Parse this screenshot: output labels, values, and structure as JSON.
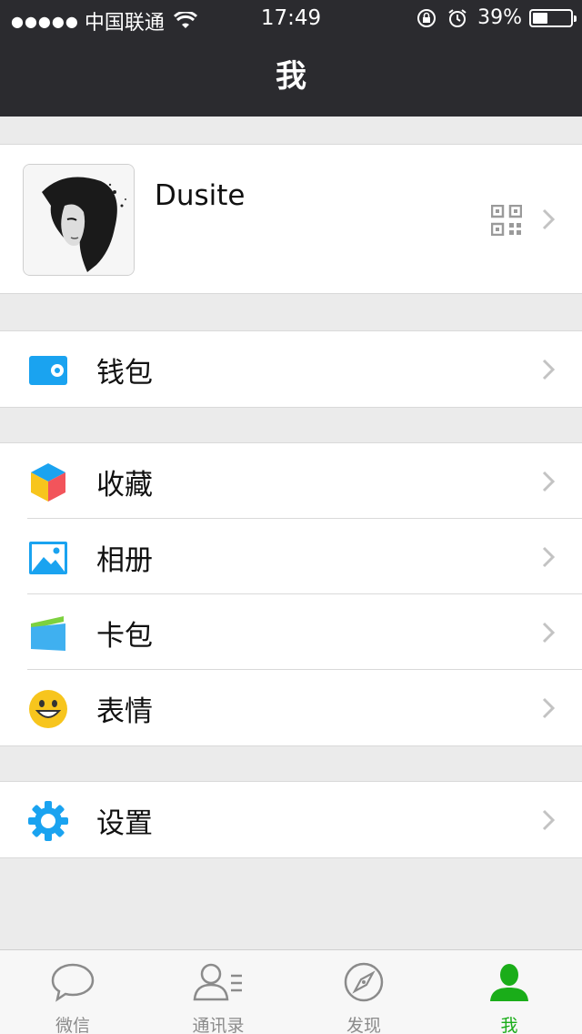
{
  "status": {
    "carrier": "中国联通",
    "time": "17:49",
    "battery": "39%",
    "battery_level": 0.39
  },
  "nav": {
    "title": "我"
  },
  "profile": {
    "name": "Dusite",
    "avatar_icon": "avatar-image",
    "qr_icon": "qr-code-icon"
  },
  "groups": [
    {
      "items": [
        {
          "label": "钱包",
          "icon": "wallet-icon"
        }
      ]
    },
    {
      "items": [
        {
          "label": "收藏",
          "icon": "favorites-cube-icon"
        },
        {
          "label": "相册",
          "icon": "album-icon"
        },
        {
          "label": "卡包",
          "icon": "card-wallet-icon"
        },
        {
          "label": "表情",
          "icon": "smiley-icon"
        }
      ]
    },
    {
      "items": [
        {
          "label": "设置",
          "icon": "gear-icon"
        }
      ]
    }
  ],
  "tabs": [
    {
      "label": "微信",
      "icon": "chat-bubble-icon",
      "active": false
    },
    {
      "label": "通讯录",
      "icon": "contacts-icon",
      "active": false
    },
    {
      "label": "发现",
      "icon": "compass-icon",
      "active": false
    },
    {
      "label": "我",
      "icon": "person-icon",
      "active": true
    }
  ],
  "colors": {
    "nav_bg": "#2b2b2f",
    "accent": "#1aad19",
    "icon_blue": "#1aa3f0"
  }
}
